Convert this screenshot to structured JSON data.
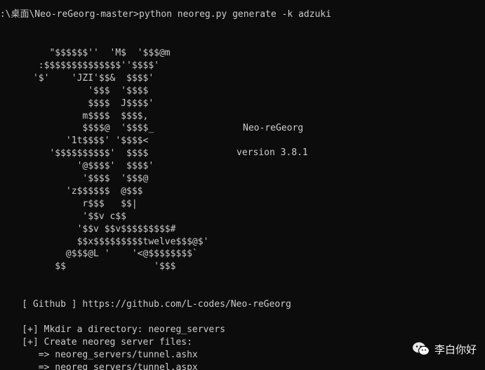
{
  "terminal": {
    "prompt_line": "E:\\桌面\\Neo-reGeorg-master>python neoreg.py generate -k adzuki",
    "banner_lines": [
      "         \"$$$$$$''  'M$  '$$$@m",
      "       :$$$$$$$$$$$$$$''$$$$'",
      "      '$'    'JZI'$$&  $$$$'",
      "                '$$$  '$$$$",
      "                $$$$  J$$$$'",
      "               m$$$$  $$$$,",
      "               $$$$@  '$$$$_",
      "            '1t$$$$' '$$$$<",
      "         '$$$$$$$$$$'  $$$$",
      "              '@$$$$'  $$$$'",
      "               '$$$$  '$$$@",
      "            'z$$$$$$  @$$$",
      "               r$$$   $$|",
      "               '$$v c$$",
      "              '$$v $$v$$$$$$$$$#",
      "              $$x$$$$$$$$$twelve$$$@$'",
      "            @$$$@L '    '<@$$$$$$$$`",
      "          $$                '$$$"
    ],
    "banner_title": "Neo-reGeorg",
    "banner_version": "version 3.8.1",
    "github_line": "    [ Github ] https://github.com/L-codes/Neo-reGeorg",
    "output_lines": [
      "    [+] Mkdir a directory: neoreg_servers",
      "    [+] Create neoreg server files:",
      "       => neoreg_servers/tunnel.ashx",
      "       => neoreg_servers/tunnel.aspx"
    ]
  },
  "watermark": {
    "icon": "wechat-icon",
    "text": "李白你好"
  }
}
